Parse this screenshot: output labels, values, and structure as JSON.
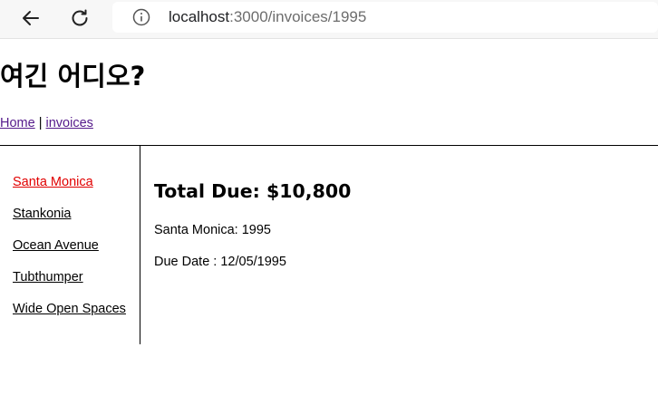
{
  "browser": {
    "back_icon": "arrow-left-icon",
    "reload_icon": "reload-icon",
    "info_icon": "info-circle-icon",
    "url_host": "localhost",
    "url_rest": ":3000/invoices/1995"
  },
  "page": {
    "title": "여긴 어디오?",
    "nav": {
      "home": "Home",
      "separator": " | ",
      "invoices": "invoices"
    }
  },
  "sidebar": {
    "items": [
      {
        "label": "Santa Monica",
        "active": true
      },
      {
        "label": "Stankonia",
        "active": false
      },
      {
        "label": "Ocean Avenue",
        "active": false
      },
      {
        "label": "Tubthumper",
        "active": false
      },
      {
        "label": "Wide Open Spaces",
        "active": false
      }
    ],
    "active_color": "#e10000"
  },
  "invoice": {
    "total_due": "Total Due: $10,800",
    "line_name": "Santa Monica: 1995",
    "line_due_date": "Due Date : 12/05/1995"
  },
  "colors": {
    "visited_link": "#551a8b",
    "active_link": "#e10000"
  }
}
